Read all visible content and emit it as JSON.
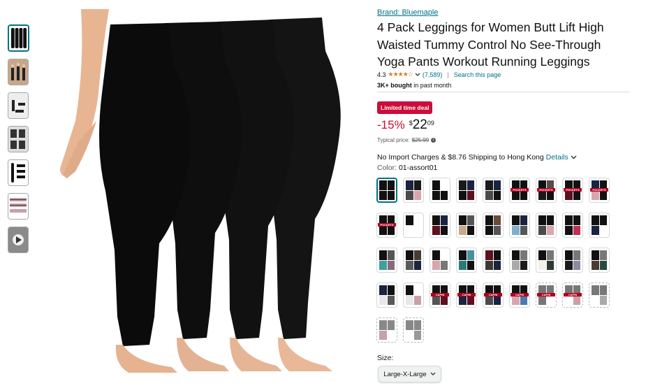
{
  "brand_link": "Brand: Bluemaple",
  "title": "4 Pack Leggings for Women Butt Lift High Waisted Tummy Control No See-Through Yoga Pants Workout Running Leggings",
  "rating": {
    "value": "4.3",
    "stars": "★★★★☆",
    "count": "(7,589)",
    "search_link": "Search this page"
  },
  "bought": {
    "bold": "3K+ bought",
    "rest": " in past month"
  },
  "deal_badge": "Limited time deal",
  "price": {
    "discount": "-15%",
    "currency": "$",
    "whole": "22",
    "fraction": "09"
  },
  "typical": {
    "label": "Typical price:",
    "value": "$25.99"
  },
  "shipping": {
    "text": "No Import Charges & $8.76 Shipping to Hong Kong",
    "details": "Details"
  },
  "color": {
    "label": "Color:",
    "value": "01-assort01"
  },
  "size": {
    "label": "Size:",
    "value": "Large-X-Large"
  },
  "icons": {
    "share": "share-icon",
    "info": "info-icon",
    "chevron": "chevron-down-icon",
    "play": "play-icon"
  },
  "swatches": [
    {
      "c": [
        "#111",
        "#111",
        "#111",
        "#111"
      ],
      "sel": true
    },
    {
      "c": [
        "#1a2340",
        "#1a1a1a",
        "#4a4a4a",
        "#d9a5ad"
      ]
    },
    {
      "c": [
        "#111",
        "#fff",
        "#111",
        "#111"
      ]
    },
    {
      "c": [
        "#1a1a1a",
        "#1a2340",
        "#111",
        "#5c1020"
      ]
    },
    {
      "c": [
        "#1a1a1a",
        "#1a2340",
        "#4a4a4a",
        "#111"
      ]
    },
    {
      "c": [
        "#111",
        "#111",
        "#111",
        "#111"
      ],
      "tag": "POCKETS"
    },
    {
      "c": [
        "#111",
        "#5b4a4a",
        "#1a1a1a",
        "#111"
      ],
      "tag": "POCKETS"
    },
    {
      "c": [
        "#111",
        "#111",
        "#5c1020",
        "#111"
      ],
      "tag": "POCKETS"
    },
    {
      "c": [
        "#1a2340",
        "#111",
        "#d9a5ad",
        "#111"
      ],
      "tag": "POCKETS"
    },
    {
      "c": [
        "#111",
        "#111",
        "#111",
        "#111"
      ],
      "tag": "POCKETS"
    },
    {
      "c": [
        "#111",
        "#fff",
        "#fff",
        "#fff"
      ]
    },
    {
      "c": [
        "#111",
        "#1a2340",
        "#5c1020",
        "#111"
      ]
    },
    {
      "c": [
        "#111",
        "#555",
        "#c8a98a",
        "#111"
      ]
    },
    {
      "c": [
        "#111",
        "#6b4a3a",
        "#111",
        "#555"
      ]
    },
    {
      "c": [
        "#111",
        "#1a2340",
        "#7fb0c8",
        "#555"
      ]
    },
    {
      "c": [
        "#111",
        "#111",
        "#4a4a4a",
        "#d9a5ad"
      ]
    },
    {
      "c": [
        "#111",
        "#111",
        "#111",
        "#c03050"
      ]
    },
    {
      "c": [
        "#111",
        "#111",
        "#1a2340",
        "#fff"
      ]
    },
    {
      "c": [
        "#111",
        "#555",
        "#3fa0a0",
        "#8a6a7a"
      ]
    },
    {
      "c": [
        "#111",
        "#4a3a30",
        "#5a5a5a",
        "#1a2340"
      ]
    },
    {
      "c": [
        "#111",
        "#fff",
        "#d9a5ad",
        "#777"
      ]
    },
    {
      "c": [
        "#111",
        "#4a90a0",
        "#2a7a7a",
        "#111"
      ]
    },
    {
      "c": [
        "#5c1020",
        "#111",
        "#3a3a30",
        "#1a2340"
      ]
    },
    {
      "c": [
        "#111",
        "#777",
        "#aaa",
        "#1a1a1a"
      ]
    },
    {
      "c": [
        "#111",
        "#777",
        "#f5f0e6",
        "#2a3a30"
      ]
    },
    {
      "c": [
        "#111",
        "#777",
        "#1a1a1a",
        "#8a8aa0"
      ]
    },
    {
      "c": [
        "#111",
        "#777",
        "#4a3a30",
        "#2a4a40"
      ]
    },
    {
      "c": [
        "#1a2340",
        "#111",
        "#e8e8e8",
        "#5a5a5a"
      ]
    },
    {
      "c": [
        "#111",
        "#fff",
        "#e8e8e8",
        "#c9a0a8"
      ]
    },
    {
      "c": [
        "#111",
        "#111",
        "#555",
        "#5c1020"
      ],
      "tag": "CAPRI"
    },
    {
      "c": [
        "#111",
        "#111",
        "#1a2340",
        "#5c1020"
      ],
      "tag": "CAPRI"
    },
    {
      "c": [
        "#111",
        "#111",
        "#4a4a4a",
        "#1a2340"
      ],
      "tag": "CAPRI"
    },
    {
      "c": [
        "#111",
        "#111",
        "#d9a5ad",
        "#4a7ab0"
      ],
      "tag": "CAPRI"
    },
    {
      "c": [
        "#777",
        "#777",
        "#777",
        "#fff"
      ],
      "tag": "CAPRI",
      "un": true
    },
    {
      "c": [
        "#777",
        "#777",
        "#fff",
        "#c9a0a8"
      ],
      "tag": "CAPRI",
      "un": true
    },
    {
      "c": [
        "#777",
        "#777",
        "#fff",
        "#aaa"
      ],
      "un": true
    },
    {
      "c": [
        "#888",
        "#888",
        "#c9a0a8",
        "#fff"
      ],
      "un": true
    },
    {
      "c": [
        "#888",
        "#888",
        "#fff",
        "#999"
      ],
      "un": true
    }
  ]
}
